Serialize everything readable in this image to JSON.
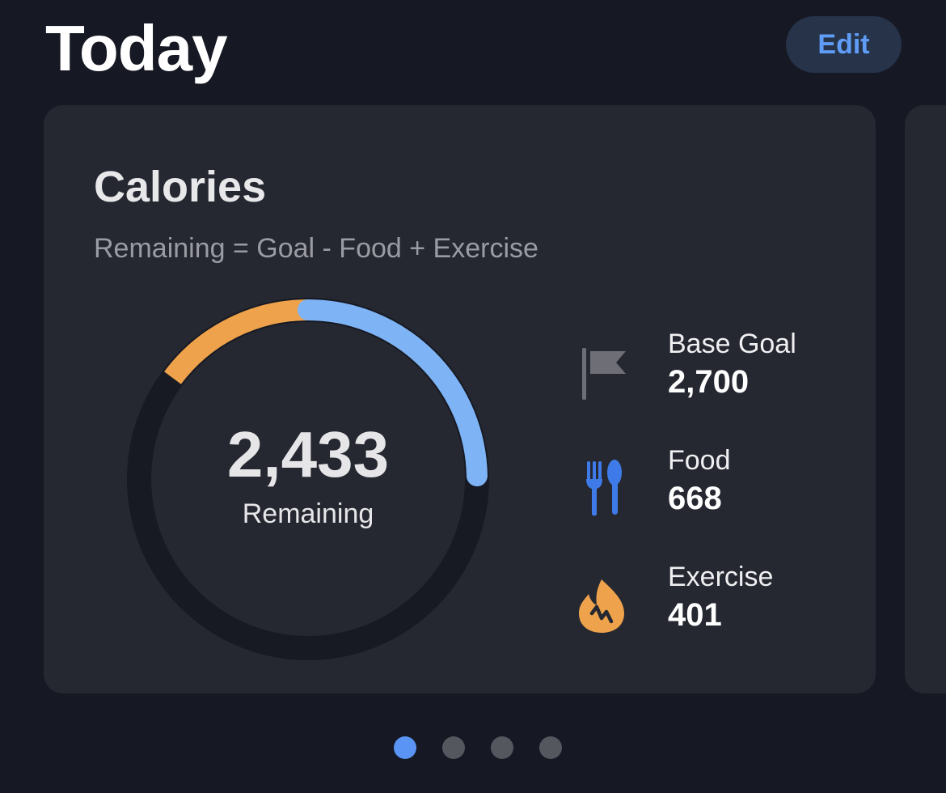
{
  "header": {
    "title": "Today",
    "edit_label": "Edit"
  },
  "card": {
    "title": "Calories",
    "subtitle": "Remaining = Goal - Food + Exercise",
    "remaining_value": "2,433",
    "remaining_label": "Remaining",
    "ring": {
      "exercise_fraction": 0.148,
      "food_fraction": 0.247,
      "colors": {
        "track": "#171923",
        "exercise": "#eea24b",
        "food": "#7eb4f5"
      }
    },
    "stats": [
      {
        "label": "Base Goal",
        "value": "2,700",
        "icon": "flag-icon",
        "color": "#6e6f76"
      },
      {
        "label": "Food",
        "value": "668",
        "icon": "fork-spoon-icon",
        "color": "#3e7be8"
      },
      {
        "label": "Exercise",
        "value": "401",
        "icon": "flame-icon",
        "color": "#eea24b"
      }
    ]
  },
  "pager": {
    "count": 4,
    "active_index": 0
  }
}
